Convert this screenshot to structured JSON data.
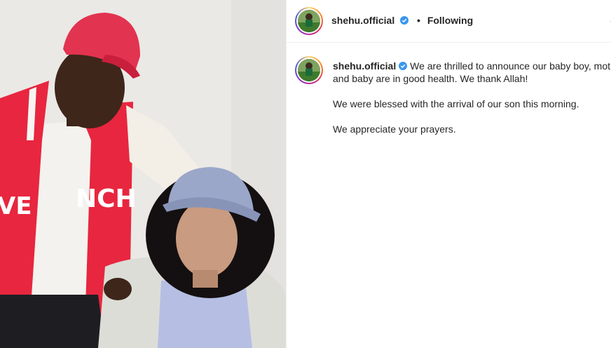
{
  "post": {
    "username": "shehu.official",
    "verified": true,
    "follow_status": "Following",
    "separator": "•",
    "more_icon": "more-options-icon"
  },
  "caption": {
    "username": "shehu.official",
    "line1": "We are thrilled to announce our baby boy, moth",
    "line2": "and baby are in good health. We thank Allah!",
    "line3": "We were blessed with the arrival of our son this morning.",
    "line4": "We appreciate your prayers."
  },
  "photo": {
    "jacket_text": "NCH",
    "jacket_text_left": "VE",
    "colors": {
      "jacket": "#e8263f",
      "cap": "#e23350",
      "bucket_hat": "#9aa7c9",
      "wall": "#eae8e4"
    }
  },
  "colors": {
    "verified": "#3897f0",
    "text": "#262626",
    "divider": "#efefef"
  }
}
